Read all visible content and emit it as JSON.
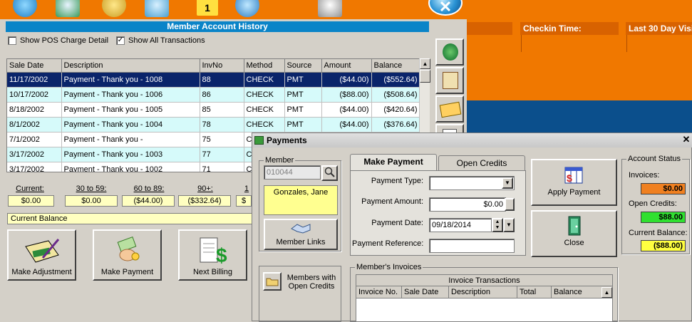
{
  "member_account_history": {
    "title": "Member Account History",
    "show_pos_charge_detail": "Show POS Charge Detail",
    "show_all_transactions": "Show All Transactions",
    "columns": [
      "Sale Date",
      "Description",
      "InvNo",
      "Method",
      "Source",
      "Amount",
      "Balance"
    ],
    "rows": [
      [
        "11/17/2002",
        "Payment - Thank you - 1008",
        "88",
        "CHECK",
        "PMT",
        "($44.00)",
        "($552.64)"
      ],
      [
        "10/17/2002",
        "Payment - Thank you - 1006",
        "86",
        "CHECK",
        "PMT",
        "($88.00)",
        "($508.64)"
      ],
      [
        "8/18/2002",
        "Payment - Thank you - 1005",
        "85",
        "CHECK",
        "PMT",
        "($44.00)",
        "($420.64)"
      ],
      [
        "8/1/2002",
        "Payment - Thank you - 1004",
        "78",
        "CHECK",
        "PMT",
        "($44.00)",
        "($376.64)"
      ],
      [
        "7/1/2002",
        "Payment - Thank you -",
        "75",
        "C",
        "",
        "",
        ""
      ],
      [
        "3/17/2002",
        "Payment - Thank you - 1003",
        "77",
        "C",
        "",
        "",
        ""
      ],
      [
        "3/17/2002",
        "Payment - Thank you - 1002",
        "71",
        "C",
        "",
        "",
        ""
      ]
    ],
    "aging": {
      "labels": [
        "Current:",
        "30 to 59:",
        "60 to 89:",
        "90+:",
        "1"
      ],
      "values": [
        "$0.00",
        "$0.00",
        "($44.00)",
        "($332.64)",
        "$"
      ]
    },
    "current_balance_label": "Current Balance",
    "buttons": {
      "make_adjustment": "Make Adjustment",
      "make_payment": "Make Payment",
      "next_billing": "Next Billing"
    }
  },
  "right_pane": {
    "checkin_time": "Checkin Time:",
    "last_30_day": "Last 30 Day Visi"
  },
  "payments": {
    "title": "Payments",
    "member_group": "Member",
    "member_id": "010044",
    "member_name": "Gonzales, Jane",
    "member_links": "Member Links",
    "members_with_credits": "Members with Open Credits",
    "tabs": {
      "make_payment": "Make Payment",
      "open_credits": "Open Credits"
    },
    "labels": {
      "payment_type": "Payment Type:",
      "payment_amount": "Payment Amount:",
      "payment_date": "Payment Date:",
      "payment_reference": "Payment Reference:"
    },
    "values": {
      "payment_type": "",
      "payment_amount": "$0.00",
      "payment_date": "09/18/2014",
      "payment_reference": ""
    },
    "apply_payment": "Apply Payment",
    "close": "Close",
    "account_status": {
      "title": "Account Status",
      "invoices_label": "Invoices:",
      "invoices_value": "$0.00",
      "open_credits_label": "Open Credits:",
      "open_credits_value": "$88.00",
      "current_balance_label": "Current Balance:",
      "current_balance_value": "($88.00)"
    },
    "members_invoices": {
      "title": "Member's Invoices",
      "header": "Invoice Transactions",
      "columns": [
        "Invoice No.",
        "Sale Date",
        "Description",
        "Total",
        "Balance"
      ]
    }
  },
  "colors": {
    "accent_orange": "#f07800",
    "title_blue": "#0a84c8",
    "selected_row": "#0a246a",
    "invoices_bg": "#f08020",
    "open_credits_bg": "#30e030",
    "current_balance_bg": "#ffff40"
  }
}
